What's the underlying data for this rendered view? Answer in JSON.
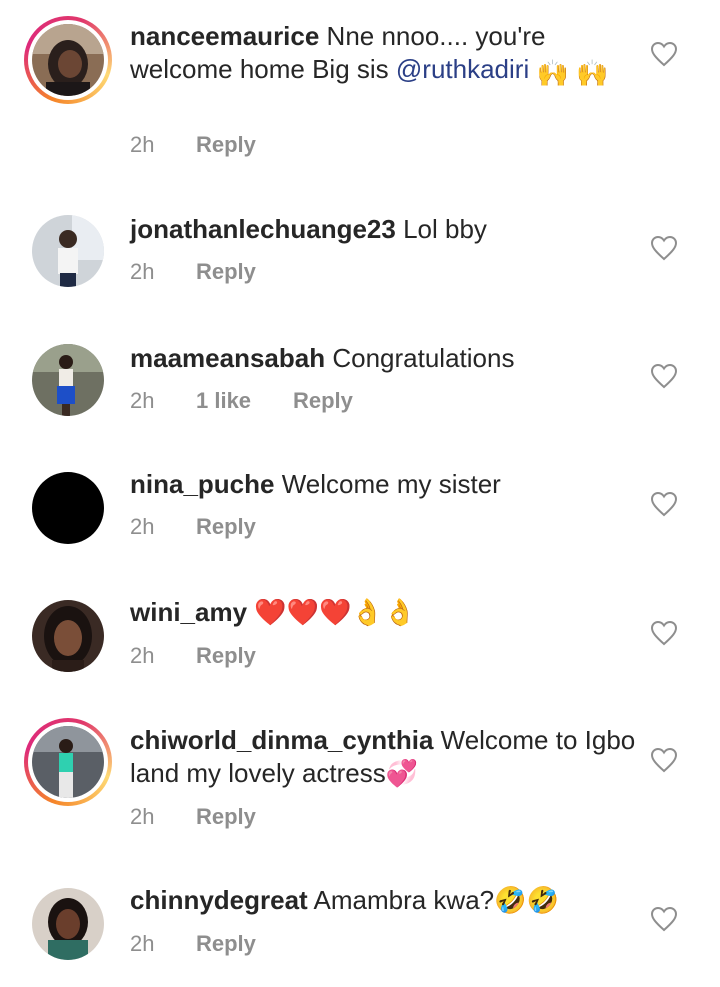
{
  "comments": [
    {
      "username": "nanceemaurice",
      "text": " Nne nnoo.... you're welcome home Big sis ",
      "mention": "@ruthkadiri",
      "emoji": "🙌 🙌",
      "time": "2h",
      "reply": "Reply"
    },
    {
      "username": "jonathanlechuange23",
      "text": " Lol bby",
      "time": "2h",
      "reply": "Reply"
    },
    {
      "username": "maameansabah",
      "text": " Congratulations",
      "time": "2h",
      "likes": "1 like",
      "reply": "Reply"
    },
    {
      "username": "nina_puche",
      "text": " Welcome my sister",
      "time": "2h",
      "reply": "Reply"
    },
    {
      "username": "wini_amy",
      "text": " ❤️❤️❤️👌👌",
      "time": "2h",
      "reply": "Reply"
    },
    {
      "username": "chiworld_dinma_cynthia",
      "text": " Welcome to Igbo land my lovely actress💞",
      "time": "2h",
      "reply": "Reply"
    },
    {
      "username": "chinnydegreat",
      "text": " Amambra kwa?🤣🤣",
      "time": "2h",
      "reply": "Reply"
    }
  ],
  "colors": {
    "username": "#262626",
    "meta": "#8e8e8e",
    "mention": "#2b3f86",
    "heart_outline": "#8e8e8e"
  },
  "icons": {
    "like": "heart-outline-icon"
  }
}
